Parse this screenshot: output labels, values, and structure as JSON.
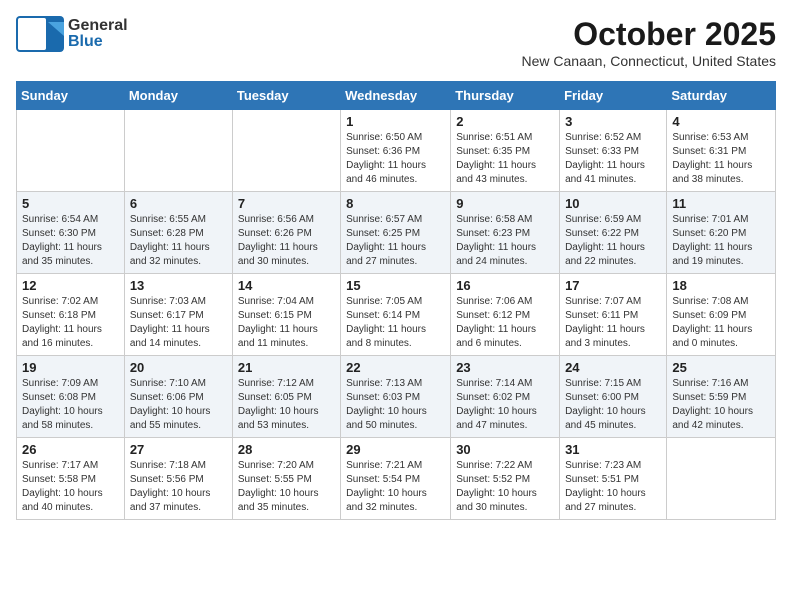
{
  "header": {
    "logo_general": "General",
    "logo_blue": "Blue",
    "month": "October 2025",
    "location": "New Canaan, Connecticut, United States"
  },
  "days_of_week": [
    "Sunday",
    "Monday",
    "Tuesday",
    "Wednesday",
    "Thursday",
    "Friday",
    "Saturday"
  ],
  "weeks": [
    [
      {
        "day": "",
        "info": ""
      },
      {
        "day": "",
        "info": ""
      },
      {
        "day": "",
        "info": ""
      },
      {
        "day": "1",
        "info": "Sunrise: 6:50 AM\nSunset: 6:36 PM\nDaylight: 11 hours\nand 46 minutes."
      },
      {
        "day": "2",
        "info": "Sunrise: 6:51 AM\nSunset: 6:35 PM\nDaylight: 11 hours\nand 43 minutes."
      },
      {
        "day": "3",
        "info": "Sunrise: 6:52 AM\nSunset: 6:33 PM\nDaylight: 11 hours\nand 41 minutes."
      },
      {
        "day": "4",
        "info": "Sunrise: 6:53 AM\nSunset: 6:31 PM\nDaylight: 11 hours\nand 38 minutes."
      }
    ],
    [
      {
        "day": "5",
        "info": "Sunrise: 6:54 AM\nSunset: 6:30 PM\nDaylight: 11 hours\nand 35 minutes."
      },
      {
        "day": "6",
        "info": "Sunrise: 6:55 AM\nSunset: 6:28 PM\nDaylight: 11 hours\nand 32 minutes."
      },
      {
        "day": "7",
        "info": "Sunrise: 6:56 AM\nSunset: 6:26 PM\nDaylight: 11 hours\nand 30 minutes."
      },
      {
        "day": "8",
        "info": "Sunrise: 6:57 AM\nSunset: 6:25 PM\nDaylight: 11 hours\nand 27 minutes."
      },
      {
        "day": "9",
        "info": "Sunrise: 6:58 AM\nSunset: 6:23 PM\nDaylight: 11 hours\nand 24 minutes."
      },
      {
        "day": "10",
        "info": "Sunrise: 6:59 AM\nSunset: 6:22 PM\nDaylight: 11 hours\nand 22 minutes."
      },
      {
        "day": "11",
        "info": "Sunrise: 7:01 AM\nSunset: 6:20 PM\nDaylight: 11 hours\nand 19 minutes."
      }
    ],
    [
      {
        "day": "12",
        "info": "Sunrise: 7:02 AM\nSunset: 6:18 PM\nDaylight: 11 hours\nand 16 minutes."
      },
      {
        "day": "13",
        "info": "Sunrise: 7:03 AM\nSunset: 6:17 PM\nDaylight: 11 hours\nand 14 minutes."
      },
      {
        "day": "14",
        "info": "Sunrise: 7:04 AM\nSunset: 6:15 PM\nDaylight: 11 hours\nand 11 minutes."
      },
      {
        "day": "15",
        "info": "Sunrise: 7:05 AM\nSunset: 6:14 PM\nDaylight: 11 hours\nand 8 minutes."
      },
      {
        "day": "16",
        "info": "Sunrise: 7:06 AM\nSunset: 6:12 PM\nDaylight: 11 hours\nand 6 minutes."
      },
      {
        "day": "17",
        "info": "Sunrise: 7:07 AM\nSunset: 6:11 PM\nDaylight: 11 hours\nand 3 minutes."
      },
      {
        "day": "18",
        "info": "Sunrise: 7:08 AM\nSunset: 6:09 PM\nDaylight: 11 hours\nand 0 minutes."
      }
    ],
    [
      {
        "day": "19",
        "info": "Sunrise: 7:09 AM\nSunset: 6:08 PM\nDaylight: 10 hours\nand 58 minutes."
      },
      {
        "day": "20",
        "info": "Sunrise: 7:10 AM\nSunset: 6:06 PM\nDaylight: 10 hours\nand 55 minutes."
      },
      {
        "day": "21",
        "info": "Sunrise: 7:12 AM\nSunset: 6:05 PM\nDaylight: 10 hours\nand 53 minutes."
      },
      {
        "day": "22",
        "info": "Sunrise: 7:13 AM\nSunset: 6:03 PM\nDaylight: 10 hours\nand 50 minutes."
      },
      {
        "day": "23",
        "info": "Sunrise: 7:14 AM\nSunset: 6:02 PM\nDaylight: 10 hours\nand 47 minutes."
      },
      {
        "day": "24",
        "info": "Sunrise: 7:15 AM\nSunset: 6:00 PM\nDaylight: 10 hours\nand 45 minutes."
      },
      {
        "day": "25",
        "info": "Sunrise: 7:16 AM\nSunset: 5:59 PM\nDaylight: 10 hours\nand 42 minutes."
      }
    ],
    [
      {
        "day": "26",
        "info": "Sunrise: 7:17 AM\nSunset: 5:58 PM\nDaylight: 10 hours\nand 40 minutes."
      },
      {
        "day": "27",
        "info": "Sunrise: 7:18 AM\nSunset: 5:56 PM\nDaylight: 10 hours\nand 37 minutes."
      },
      {
        "day": "28",
        "info": "Sunrise: 7:20 AM\nSunset: 5:55 PM\nDaylight: 10 hours\nand 35 minutes."
      },
      {
        "day": "29",
        "info": "Sunrise: 7:21 AM\nSunset: 5:54 PM\nDaylight: 10 hours\nand 32 minutes."
      },
      {
        "day": "30",
        "info": "Sunrise: 7:22 AM\nSunset: 5:52 PM\nDaylight: 10 hours\nand 30 minutes."
      },
      {
        "day": "31",
        "info": "Sunrise: 7:23 AM\nSunset: 5:51 PM\nDaylight: 10 hours\nand 27 minutes."
      },
      {
        "day": "",
        "info": ""
      }
    ]
  ]
}
